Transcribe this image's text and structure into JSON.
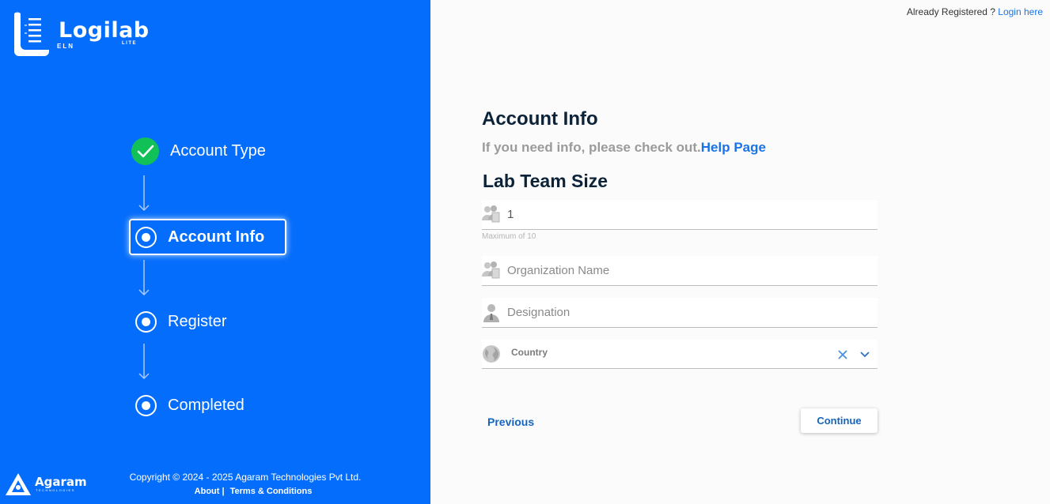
{
  "brand": {
    "name": "Logilab",
    "edition": "ELN",
    "tier": "LITE"
  },
  "steps": [
    {
      "label": "Account Type",
      "state": "completed"
    },
    {
      "label": "Account Info",
      "state": "active"
    },
    {
      "label": "Register",
      "state": "pending"
    },
    {
      "label": "Completed",
      "state": "pending"
    }
  ],
  "footer": {
    "company_logo": "Agaram",
    "company_logo_sub": "TECHNOLOGIES",
    "copyright": "Copyright © 2024 - 2025 Agaram Technologies Pvt Ltd.",
    "about": "About |",
    "terms": "Terms & Conditions"
  },
  "header": {
    "already_text": "Already Registered ?",
    "login_link": "Login here"
  },
  "form": {
    "title": "Account Info",
    "subtitle": "If you need info, please check out.",
    "help_link": "Help Page",
    "section": "Lab Team Size",
    "team_size": {
      "value": "1",
      "hint": "Maximum of 10",
      "icon": "team-icon"
    },
    "organization": {
      "placeholder": "Organization Name",
      "icon": "organization-icon"
    },
    "designation": {
      "placeholder": "Designation",
      "icon": "user-icon"
    },
    "country": {
      "label": "Country",
      "icon": "globe-icon"
    },
    "previous": "Previous",
    "continue": "Continue"
  },
  "colors": {
    "panel": "#056dfb",
    "check": "#11c157",
    "link": "#1a73e8",
    "heading": "#0c2238"
  }
}
